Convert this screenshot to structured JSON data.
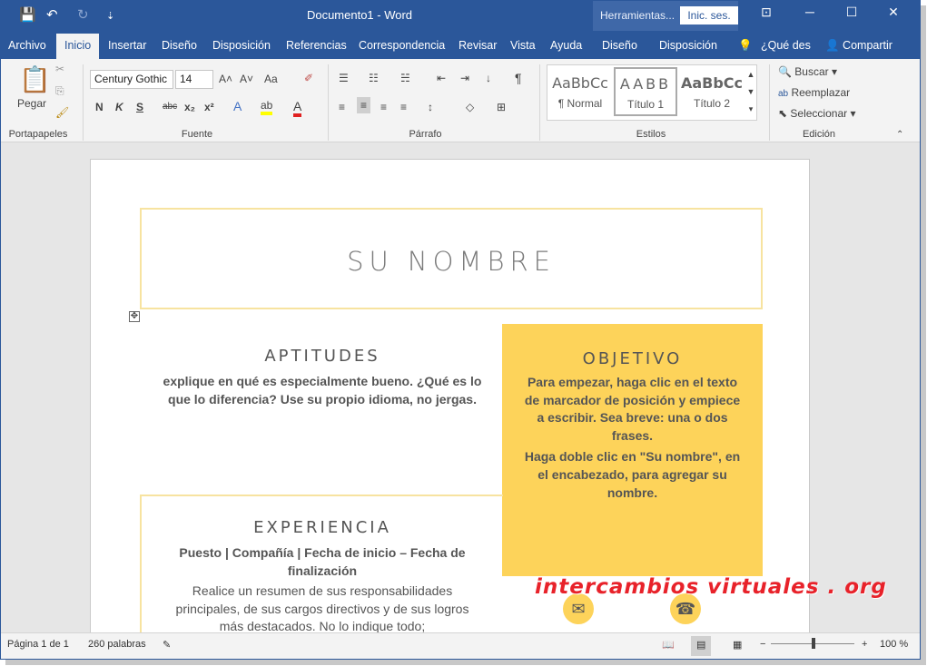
{
  "window": {
    "title": "Documento1 - Word",
    "context_label": "Herramientas...",
    "signin": "Inic. ses."
  },
  "quick_access": {
    "save": "💾",
    "undo": "↶",
    "redo": "↻",
    "customize": "⇣"
  },
  "window_controls": {
    "ribbon_display": "⊡",
    "minimize": "─",
    "maximize": "☐",
    "close": "✕"
  },
  "tabs": [
    {
      "label": "Archivo"
    },
    {
      "label": "Inicio"
    },
    {
      "label": "Insertar"
    },
    {
      "label": "Diseño"
    },
    {
      "label": "Disposición"
    },
    {
      "label": "Referencias"
    },
    {
      "label": "Correspondencia"
    },
    {
      "label": "Revisar"
    },
    {
      "label": "Vista"
    },
    {
      "label": "Ayuda"
    },
    {
      "label": "Diseño"
    },
    {
      "label": "Disposición"
    }
  ],
  "tell_me": "¿Qué des",
  "share": "Compartir",
  "ribbon": {
    "clipboard": {
      "paste": "Pegar",
      "label": "Portapapeles"
    },
    "font": {
      "name": "Century Gothic",
      "size": "14",
      "label": "Fuente",
      "bold": "N",
      "italic": "K",
      "underline": "S",
      "strike": "abc",
      "sub": "x₂",
      "sup": "x²",
      "grow": "A˄",
      "shrink": "A˅",
      "case": "Aa",
      "clear": "✐"
    },
    "paragraph": {
      "label": "Párrafo",
      "pilcrow": "¶"
    },
    "styles": {
      "label": "Estilos",
      "items": [
        {
          "sample": "AaBbCc",
          "name": "¶ Normal"
        },
        {
          "sample": "AABB",
          "name": "Título 1"
        },
        {
          "sample": "AaBbCc",
          "name": "Título 2"
        }
      ]
    },
    "editing": {
      "label": "Edición",
      "find": "Buscar",
      "replace": "Reemplazar",
      "select": "Seleccionar"
    }
  },
  "document": {
    "name": "SU NOMBRE",
    "skills_heading": "APTITUDES",
    "skills_text": "explique en qué es especialmente bueno. ¿Qué es lo que lo diferencia? Use su propio idioma, no jergas.",
    "objective_heading": "OBJETIVO",
    "objective_text1": "Para empezar, haga clic en el texto de marcador de posición y empiece a escribir. Sea breve: una o dos frases.",
    "objective_text2": "Haga doble clic en \"Su nombre\", en el encabezado, para agregar su nombre.",
    "experience_heading": "EXPERIENCIA",
    "experience_sub": "Puesto | Compañía | Fecha de inicio – Fecha de finalización",
    "experience_text": "Realice un resumen de sus responsabilidades principales, de sus cargos directivos y de sus logros más destacados. No lo indique todo;",
    "move_handle": "✥",
    "email_icon": "✉",
    "phone_icon": "☎"
  },
  "watermark": "intercambios virtuales . org",
  "status": {
    "page": "Página 1 de 1",
    "words": "260 palabras",
    "zoom": "100 %"
  }
}
